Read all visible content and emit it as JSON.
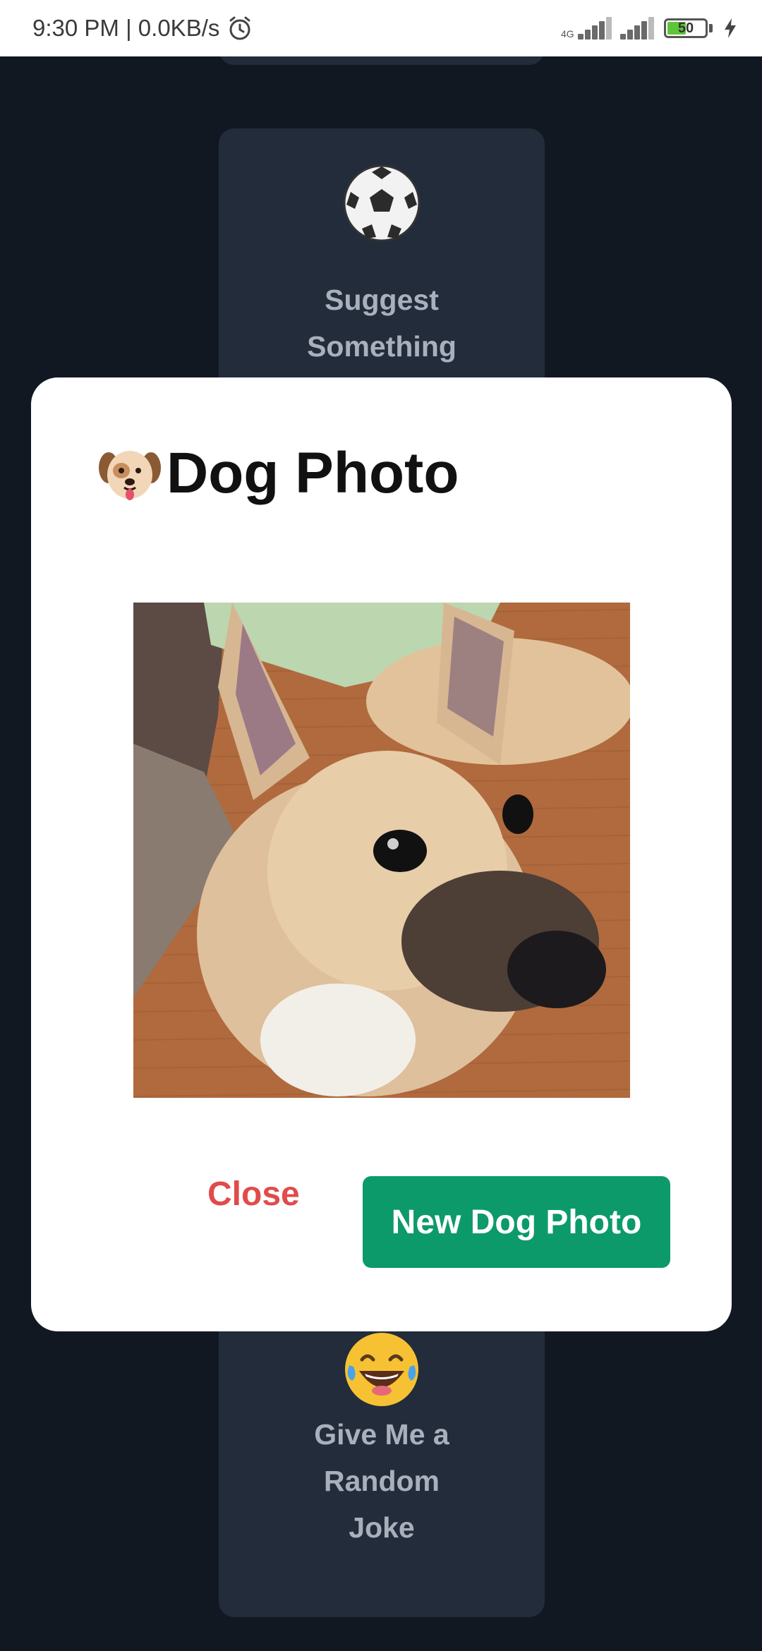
{
  "status_bar": {
    "time_speed": "9:30 PM | 0.0KB/s",
    "network_type": "4G",
    "battery_level": "50"
  },
  "cards": [
    {
      "emoji_name": "soccer-ball-icon",
      "label_lines": [
        "Suggest",
        "Something"
      ]
    },
    {
      "emoji_name": "laughing-face-icon",
      "label_lines": [
        "Give Me a",
        "Random",
        "Joke"
      ]
    }
  ],
  "dialog": {
    "title": "Dog Photo",
    "close_label": "Close",
    "new_photo_label": "New Dog Photo"
  },
  "colors": {
    "background": "#111822",
    "card": "#222c3b",
    "primary_button": "#0c9a6a",
    "close_text": "#e04b4b"
  }
}
